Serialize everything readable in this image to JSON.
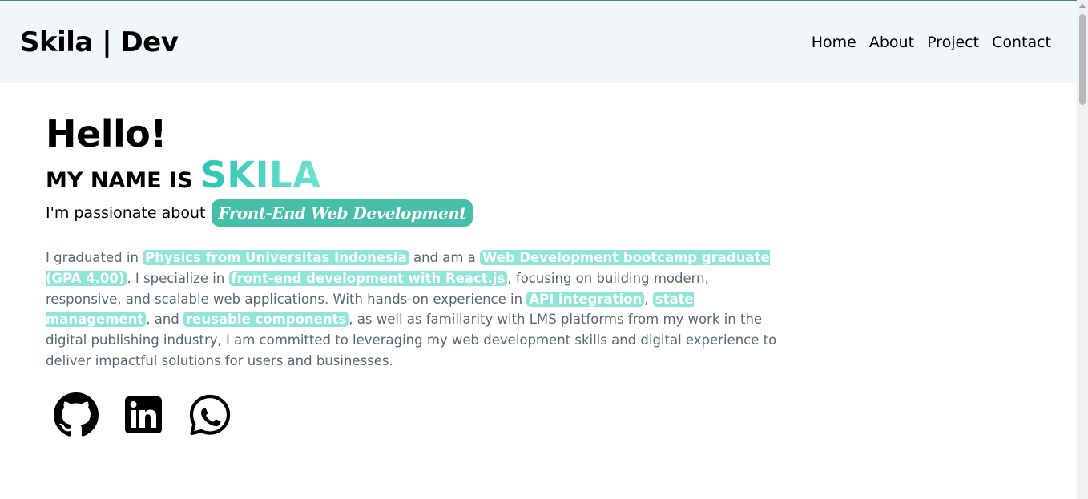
{
  "header": {
    "brand": "Skila | Dev",
    "nav": [
      {
        "label": "Home"
      },
      {
        "label": "About"
      },
      {
        "label": "Project"
      },
      {
        "label": "Contact"
      }
    ]
  },
  "hero": {
    "greeting": "Hello!",
    "name_prefix": "MY NAME IS",
    "name": "SKILA",
    "passion_prefix": "I'm passionate about",
    "passion_badge": "Front-End Web Development",
    "bio": {
      "t1": "I graduated in ",
      "h1": "Physics from Universitas Indonesia",
      "t2": " and am a ",
      "h2": "Web Development bootcamp graduate (GPA 4.00)",
      "t3": ". I specialize in ",
      "h3": "front-end development with React.js",
      "t4": ", focusing on building modern, responsive, and scalable web applications. With hands-on experience in ",
      "h4": "API integration",
      "t5": ", ",
      "h5": "state management",
      "t6": ", and ",
      "h6": "reusable components",
      "t7": ", as well as familiarity with LMS platforms from my work in the digital publishing industry, I am committed to leveraging my web development skills and digital experience to deliver impactful solutions for users and businesses."
    }
  },
  "socials": [
    {
      "icon": "github-icon"
    },
    {
      "icon": "linkedin-icon"
    },
    {
      "icon": "whatsapp-icon"
    }
  ],
  "colors": {
    "header_bg": "#f1f6fb",
    "accent": "#45bfa8",
    "highlight": "#8fe6d6",
    "body_text": "#5b6573"
  }
}
